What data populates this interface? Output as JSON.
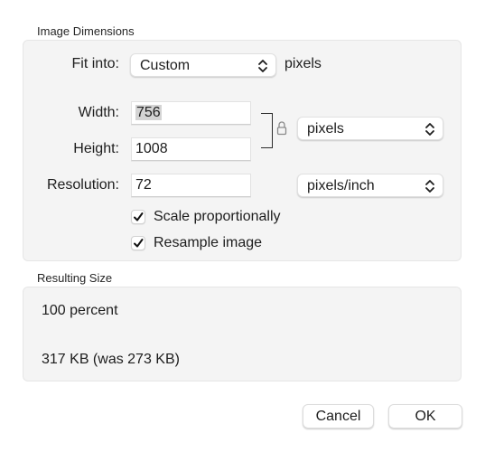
{
  "dialog": {
    "image_dimensions": {
      "section_title": "Image Dimensions",
      "fit_into": {
        "label": "Fit into:",
        "value": "Custom",
        "unit": "pixels"
      },
      "width": {
        "label": "Width:",
        "value": "756"
      },
      "height": {
        "label": "Height:",
        "value": "1008"
      },
      "size_unit": "pixels",
      "resolution": {
        "label": "Resolution:",
        "value": "72",
        "unit": "pixels/inch"
      },
      "scale_proportionally": {
        "label": "Scale proportionally",
        "checked": true
      },
      "resample_image": {
        "label": "Resample image",
        "checked": true
      }
    },
    "resulting_size": {
      "section_title": "Resulting Size",
      "percent": "100 percent",
      "file_size": "317 KB (was 273 KB)"
    },
    "buttons": {
      "cancel": "Cancel",
      "ok": "OK"
    }
  }
}
